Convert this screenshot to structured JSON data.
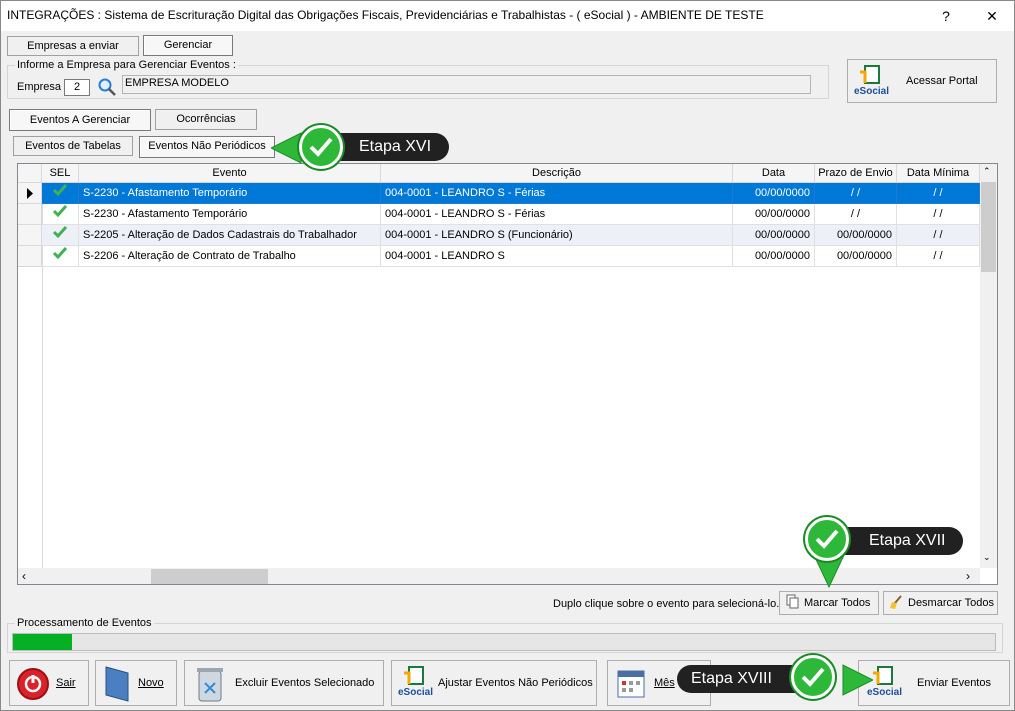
{
  "window": {
    "title": "INTEGRAÇÕES : Sistema de Escrituração Digital das Obrigações Fiscais, Previdenciárias e Trabalhistas - ( eSocial ) - AMBIENTE DE TESTE",
    "help": "?",
    "close": "✕"
  },
  "top_tabs": [
    "Empresas a enviar",
    "Gerenciar"
  ],
  "company": {
    "group_label": "Informe a Empresa para Gerenciar Eventos :",
    "label": "Empresa",
    "code": "2",
    "name": "EMPRESA MODELO"
  },
  "portal_button": "Acessar Portal",
  "esocial_logo_text": "eSocial",
  "mid_tabs": [
    "Eventos A Gerenciar",
    "Ocorrências"
  ],
  "sub_tabs": [
    "Eventos de Tabelas",
    "Eventos Não Periódicos"
  ],
  "grid": {
    "columns": [
      "SEL",
      "Evento",
      "Descrição",
      "Data",
      "Prazo de Envio",
      "Data Mínima"
    ],
    "rows": [
      {
        "evento": "S-2230 - Afastamento Temporário",
        "descricao": "004-0001 - LEANDRO S - Férias",
        "data": "00/00/0000",
        "prazo": "/ /",
        "minima": "/ /"
      },
      {
        "evento": "S-2230 - Afastamento Temporário",
        "descricao": "004-0001 - LEANDRO S - Férias",
        "data": "00/00/0000",
        "prazo": "/ /",
        "minima": "/ /"
      },
      {
        "evento": "S-2205 - Alteração de Dados Cadastrais do Trabalhador",
        "descricao": "004-0001 - LEANDRO S (Funcionário)",
        "data": "00/00/0000",
        "prazo": "00/00/0000",
        "minima": "/ /"
      },
      {
        "evento": "S-2206 - Alteração de Contrato de Trabalho",
        "descricao": "004-0001 - LEANDRO S",
        "data": "00/00/0000",
        "prazo": "00/00/0000",
        "minima": "/ /"
      }
    ]
  },
  "hint": "Duplo clique sobre o evento para selecioná-lo.",
  "mark_all": "Marcar Todos",
  "unmark_all": "Desmarcar Todos",
  "processing": {
    "label": "Processamento de Eventos",
    "progress": 0.06
  },
  "bottom": {
    "sair": "Sair",
    "novo": "Novo",
    "excluir": "Excluir Eventos Selecionado",
    "ajustar": "Ajustar Eventos Não Periódicos",
    "mes": "Mês",
    "enviar": "Enviar Eventos"
  },
  "callouts": [
    "Etapa XVI",
    "Etapa XVII",
    "Etapa XVIII"
  ],
  "colors": {
    "selection": "#0078d7",
    "progress": "#06b025",
    "callout_check": "#2db839"
  }
}
